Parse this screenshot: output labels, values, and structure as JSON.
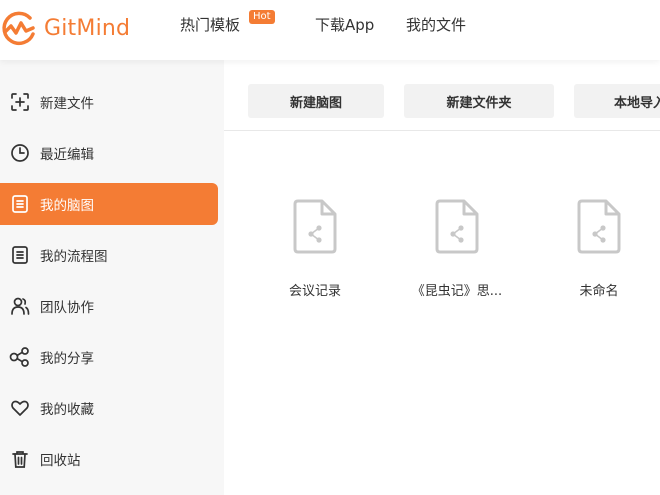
{
  "header": {
    "logo_text": "GitMind",
    "nav": {
      "templates": "热门模板",
      "hot_badge": "Hot",
      "download": "下载App",
      "my_files": "我的文件"
    }
  },
  "sidebar": {
    "items": [
      {
        "label": "新建文件",
        "icon": "add-file-icon"
      },
      {
        "label": "最近编辑",
        "icon": "clock-icon"
      },
      {
        "label": "我的脑图",
        "icon": "document-list-icon",
        "active": true
      },
      {
        "label": "我的流程图",
        "icon": "document-list-icon"
      },
      {
        "label": "团队协作",
        "icon": "team-icon"
      },
      {
        "label": "我的分享",
        "icon": "share-icon"
      },
      {
        "label": "我的收藏",
        "icon": "heart-icon"
      },
      {
        "label": "回收站",
        "icon": "trash-icon"
      }
    ]
  },
  "toolbar": {
    "new_map": "新建脑图",
    "new_folder": "新建文件夹",
    "import": "本地导入"
  },
  "files": [
    {
      "name": "会议记录"
    },
    {
      "name": "《昆虫记》思..."
    },
    {
      "name": "未命名"
    }
  ],
  "colors": {
    "accent": "#f47c34",
    "sidebar_bg": "#f7f7f7",
    "button_bg": "#f2f2f2",
    "file_icon": "#c8c8c8"
  }
}
